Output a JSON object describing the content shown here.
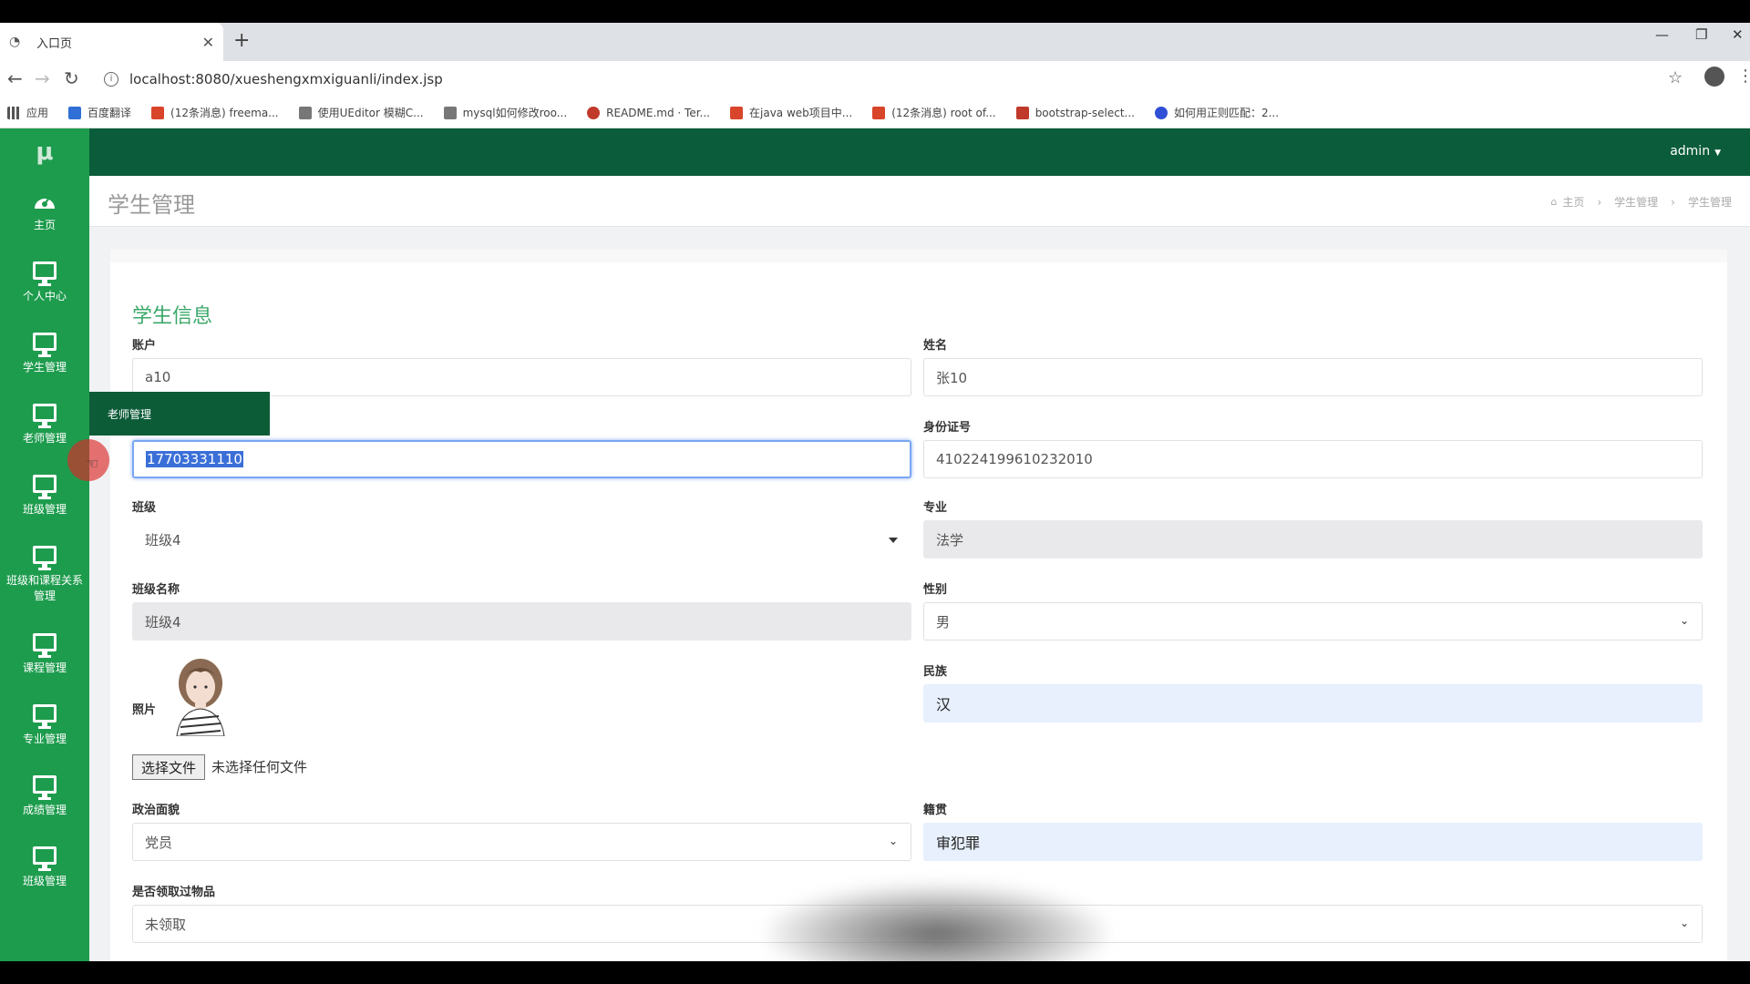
{
  "browser": {
    "tab_title": "入口页",
    "url": "localhost:8080/xueshengxmxiguanli/index.jsp",
    "bookmarks": [
      {
        "label": "应用",
        "color": "#4a4a4a"
      },
      {
        "label": "百度翻译",
        "color": "#2f6fd6"
      },
      {
        "label": "(12条消息) freema...",
        "color": "#d9452b"
      },
      {
        "label": "使用UEditor 模糊C...",
        "color": "#555555"
      },
      {
        "label": "mysql如何修改roo...",
        "color": "#555555"
      },
      {
        "label": "README.md · Ter...",
        "color": "#c0392b"
      },
      {
        "label": "在java web项目中...",
        "color": "#d9452b"
      },
      {
        "label": "(12条消息) root of...",
        "color": "#d9452b"
      },
      {
        "label": "bootstrap-select...",
        "color": "#c0392b"
      },
      {
        "label": "如何用正则匹配：2...",
        "color": "#2f4fd6"
      }
    ]
  },
  "app": {
    "logo": "μ",
    "user": "admin",
    "sidebar": [
      {
        "label": "主页",
        "icon": "dashboard-icon"
      },
      {
        "label": "个人中心",
        "icon": "monitor-icon"
      },
      {
        "label": "学生管理",
        "icon": "monitor-icon"
      },
      {
        "label": "老师管理",
        "icon": "monitor-icon"
      },
      {
        "label": "班级管理",
        "icon": "monitor-icon"
      },
      {
        "label": "班级和课程关系管理",
        "icon": "monitor-icon"
      },
      {
        "label": "课程管理",
        "icon": "monitor-icon"
      },
      {
        "label": "专业管理",
        "icon": "monitor-icon"
      },
      {
        "label": "成绩管理",
        "icon": "monitor-icon"
      },
      {
        "label": "班级管理",
        "icon": "monitor-icon"
      }
    ],
    "tooltip": "老师管理",
    "page_title": "学生管理",
    "breadcrumb": [
      "主页",
      "学生管理",
      "学生管理"
    ]
  },
  "form": {
    "title": "学生信息",
    "account": {
      "label": "账户",
      "value": "a10"
    },
    "name": {
      "label": "姓名",
      "value": "张10"
    },
    "phone": {
      "label": "",
      "value": "17703331110"
    },
    "id_card": {
      "label": "身份证号",
      "value": "410224199610232010"
    },
    "class": {
      "label": "班级",
      "value": "班级4"
    },
    "major": {
      "label": "专业",
      "value": "法学"
    },
    "class_name": {
      "label": "班级名称",
      "value": "班级4"
    },
    "gender": {
      "label": "性别",
      "value": "男"
    },
    "ethnicity": {
      "label": "民族",
      "value": "汉"
    },
    "photo": {
      "label": "照片",
      "button": "选择文件",
      "status": "未选择任何文件"
    },
    "politics": {
      "label": "政治面貌",
      "value": "党员"
    },
    "native_place": {
      "label": "籍贯",
      "value": "审犯罪"
    },
    "received": {
      "label": "是否领取过物品",
      "value": "未领取"
    }
  },
  "colors": {
    "sidebar": "#1e9c4e",
    "topbar": "#0b5c3a",
    "title_green": "#3aa869"
  }
}
